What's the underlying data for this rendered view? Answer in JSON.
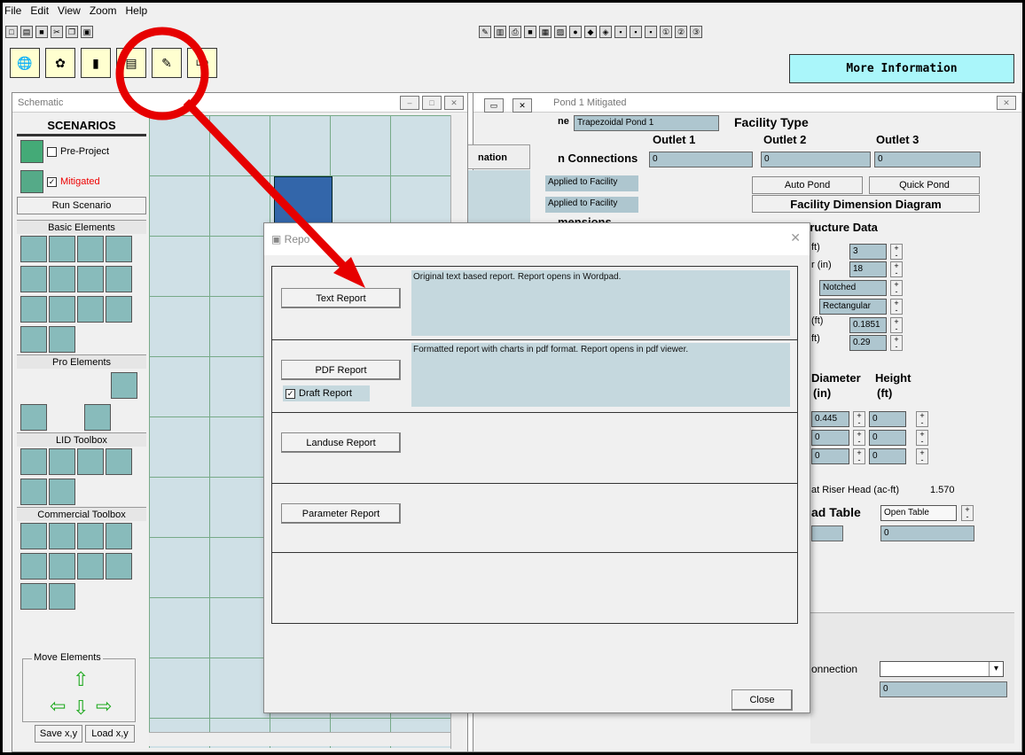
{
  "menu": [
    "File",
    "Edit",
    "View",
    "Zoom",
    "Help"
  ],
  "toolbar": {
    "more_info": "More Information"
  },
  "schematic": {
    "title": "Schematic",
    "scenarios": "SCENARIOS",
    "pre_project": "Pre-Project",
    "mitigated": "Mitigated",
    "run_scenario": "Run Scenario",
    "basic_elements": "Basic Elements",
    "pro_elements": "Pro Elements",
    "lid_toolbox": "LID Toolbox",
    "commercial_toolbox": "Commercial Toolbox",
    "move_elements": "Move Elements",
    "save_xy": "Save x,y",
    "load_xy": "Load x,y"
  },
  "mid_panel": {
    "col": "nation"
  },
  "facility": {
    "title": "Pond 1 Mitigated",
    "name_label": "ne",
    "name_value": "Trapezoidal Pond 1",
    "facility_type": "Facility Type",
    "outlet1": "Outlet 1",
    "outlet2": "Outlet 2",
    "outlet3": "Outlet 3",
    "connections": "n Connections",
    "conn1": "0",
    "conn2": "0",
    "conn3": "0",
    "applied1": "Applied to Facility",
    "applied2": "Applied to Facility",
    "dimensions": "mensions",
    "auto_pond": "Auto Pond",
    "quick_pond": "Quick Pond",
    "diagram": "Facility Dimension Diagram",
    "structure": "tructure Data",
    "r1_label": "ft)",
    "r1_val": "3",
    "r2_label": "r (in)",
    "r2_val": "18",
    "r3_val": "Notched",
    "r4_val": "Rectangular",
    "r5_label": "(ft)",
    "r5_val": "0.1851",
    "r6_label": "ft)",
    "r6_val": "0.29",
    "diameter": "Diameter",
    "height": "Height",
    "in": "(in)",
    "ft": "(ft)",
    "d1": "0.445",
    "h1": "0",
    "d2": "0",
    "h2": "0",
    "d3": "0",
    "h3": "0",
    "riser": "at Riser Head (ac-ft)",
    "riser_val": "1.570",
    "ad_table": "ad Table",
    "open_table": "Open Table",
    "zero_field": "0",
    "connection": "onnection",
    "conn_field": "0"
  },
  "dialog": {
    "title": "Repo",
    "text_report": "Text Report",
    "text_desc": "Original text based report. Report opens in Wordpad.",
    "pdf_report": "PDF Report",
    "pdf_desc": "Formatted report with charts in pdf format. Report opens in pdf viewer.",
    "draft": "Draft Report",
    "landuse": "Landuse Report",
    "parameter": "Parameter Report",
    "close": "Close"
  },
  "colors": {
    "annotation": "#e60000",
    "more_info_bg": "#aaf6fa",
    "field_bg": "#aec6cf"
  }
}
